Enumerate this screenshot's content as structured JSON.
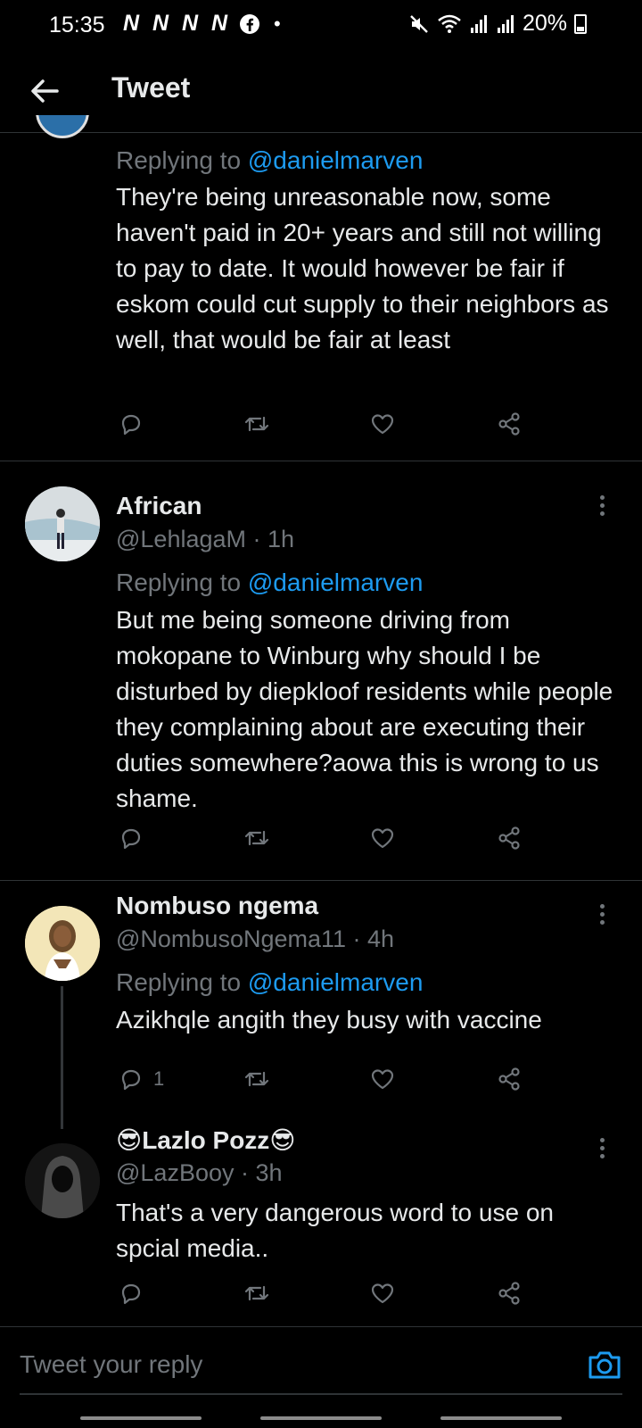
{
  "status_bar": {
    "time": "15:35",
    "notification_icons": [
      "N",
      "N",
      "N",
      "N"
    ],
    "battery": "20%"
  },
  "header": {
    "title": "Tweet"
  },
  "replying_label": "Replying to",
  "tweets": [
    {
      "mention": "@danielmarven",
      "text": "They're being unreasonable now, some haven't paid in 20+ years and still not willing to pay to date. It would however be fair if eskom could cut supply to their neighbors as well, that would be fair at least"
    },
    {
      "name": "African",
      "handle": "@LehlagaM · 1h",
      "mention": "@danielmarven",
      "text": "But me being someone driving from mokopane to Winburg why should I be disturbed by diepkloof residents while people they complaining about are executing their duties somewhere?aowa this is wrong to us shame."
    },
    {
      "name": "Nombuso ngema",
      "handle": "@NombusoNgema11 · 4h",
      "mention": "@danielmarven",
      "text": "Azikhqle angith they busy with vaccine",
      "reply_count": "1"
    },
    {
      "name": "😎Lazlo Pozz😎",
      "handle": "@LazBooy · 3h",
      "text": "That's a very dangerous word to use on spcial media.."
    }
  ],
  "reply_bar": {
    "placeholder": "Tweet your reply"
  },
  "colors": {
    "accent": "#1d9bf0",
    "muted": "#71767b",
    "text": "#e7e9ea",
    "background": "#000000",
    "divider": "#2f3336"
  }
}
